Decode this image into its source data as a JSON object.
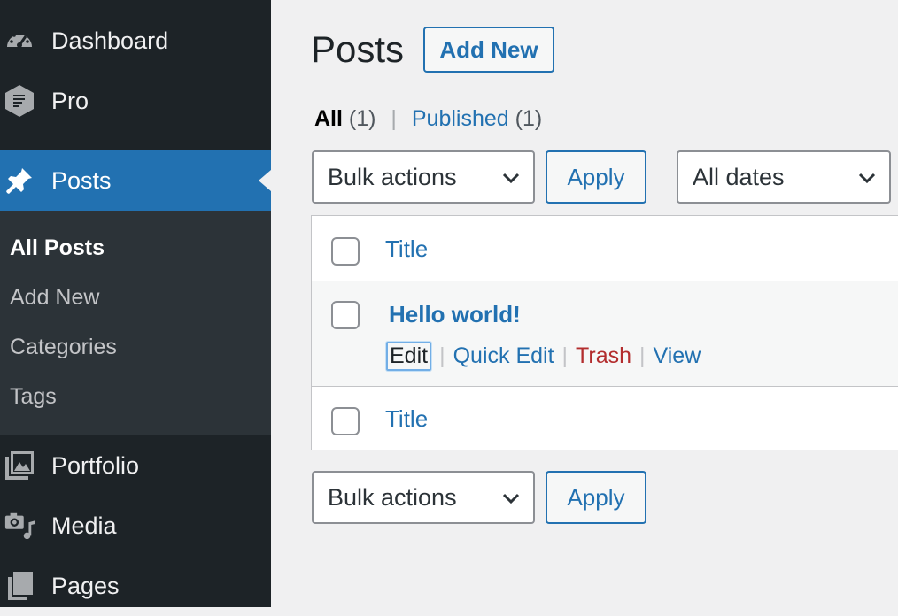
{
  "sidebar": {
    "menu": [
      {
        "label": "Dashboard",
        "icon": "dashboard-gauge-icon"
      },
      {
        "label": "Pro",
        "icon": "hexagon-pro-icon"
      },
      {
        "label": "Posts",
        "icon": "pushpin-icon",
        "current": true
      },
      {
        "label": "Portfolio",
        "icon": "gallery-images-icon"
      },
      {
        "label": "Media",
        "icon": "media-camera-music-icon"
      },
      {
        "label": "Pages",
        "icon": "page-icon"
      }
    ],
    "submenu": [
      {
        "label": "All Posts",
        "active": true
      },
      {
        "label": "Add New"
      },
      {
        "label": "Categories"
      },
      {
        "label": "Tags"
      }
    ]
  },
  "main": {
    "title": "Posts",
    "add_new": "Add New",
    "views": {
      "all_label": "All",
      "all_count": "(1)",
      "separator": "|",
      "published_label": "Published",
      "published_count": "(1)"
    },
    "bulk_actions": "Bulk actions",
    "apply": "Apply",
    "dates_filter": "All dates",
    "table": {
      "column_title": "Title",
      "post": {
        "title": "Hello world!",
        "actions": {
          "edit": "Edit",
          "quick_edit": "Quick Edit",
          "trash": "Trash",
          "view": "View"
        },
        "separator": "|"
      }
    }
  },
  "colors": {
    "sidebar_bg": "#1d2327",
    "submenu_bg": "#2c3338",
    "accent": "#2271b1",
    "trash": "#b32d2e",
    "page_bg": "#f0f0f1"
  }
}
